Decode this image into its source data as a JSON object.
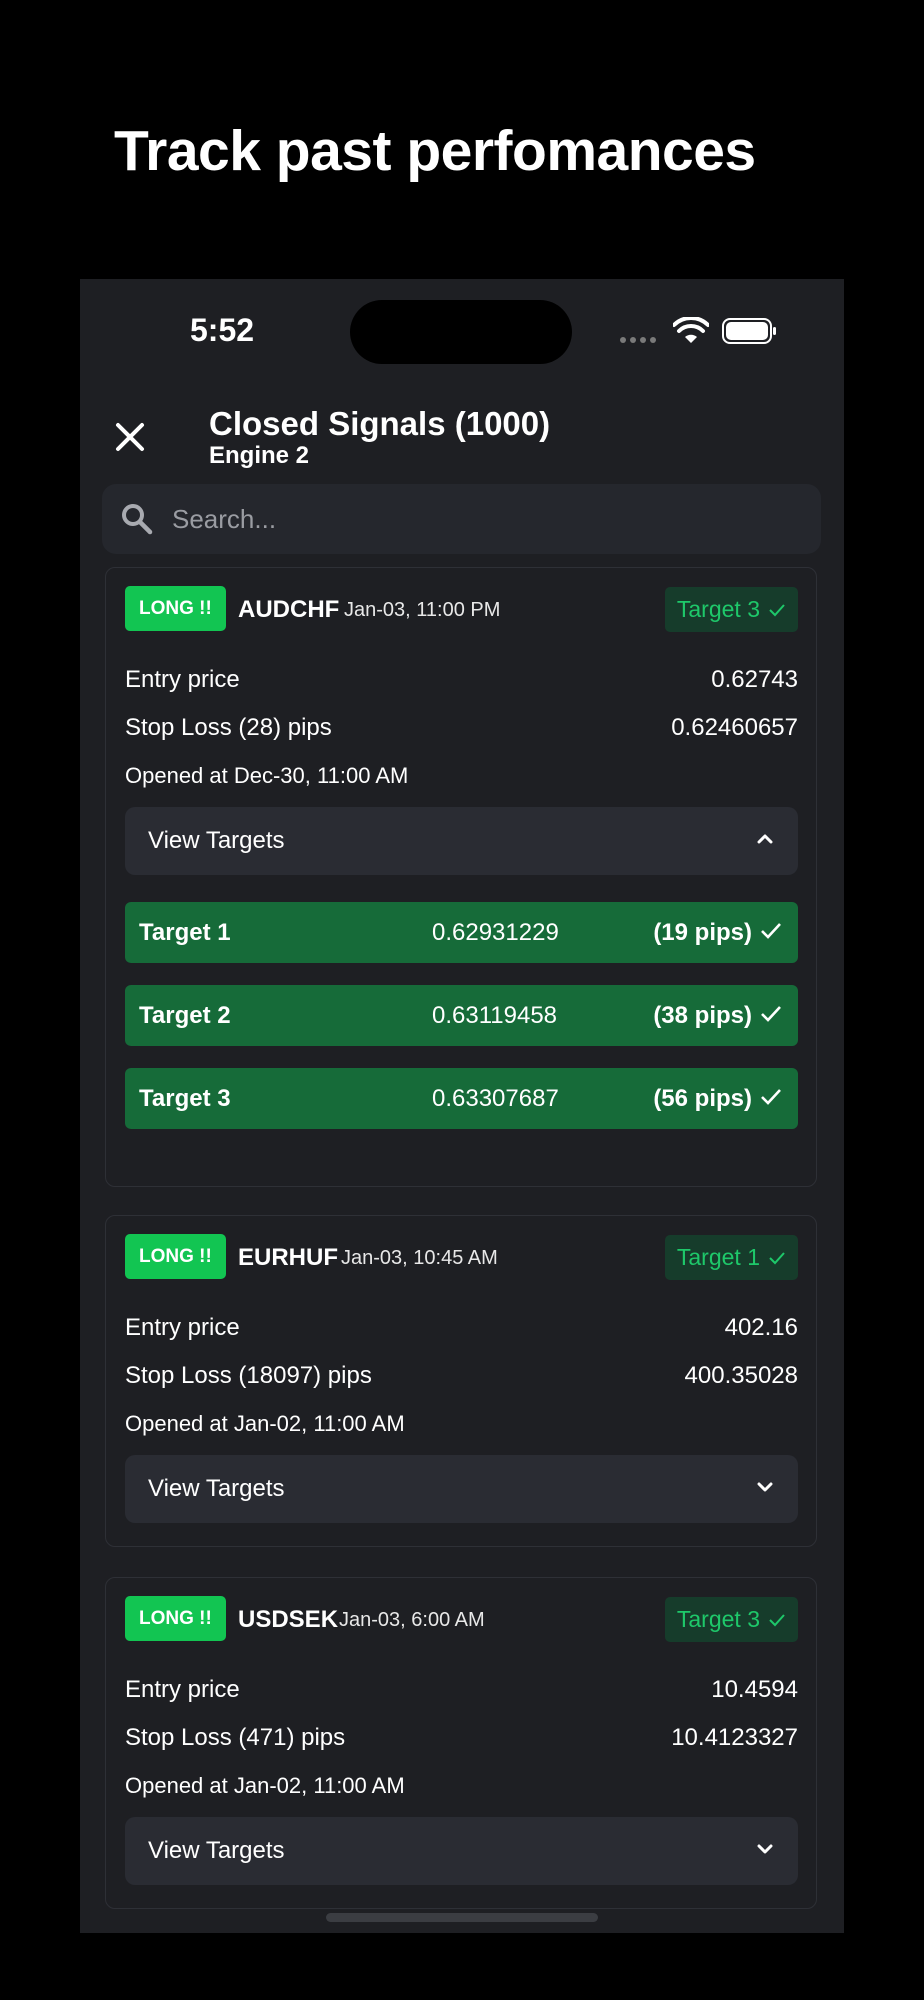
{
  "headline": "Track past perfomances",
  "status_bar": {
    "time": "5:52"
  },
  "header": {
    "title": "Closed Signals (1000)",
    "subtitle": "Engine 2"
  },
  "search": {
    "placeholder": "Search..."
  },
  "signals": [
    {
      "direction": "LONG !!",
      "pair": "AUDCHF",
      "date": "Jan-03, 11:00 PM",
      "target_badge": "Target 3",
      "entry_label": "Entry price",
      "entry_value": "0.62743",
      "stop_label": "Stop Loss (28) pips",
      "stop_value": "0.62460657",
      "opened": "Opened at Dec-30, 11:00 AM",
      "view_targets_label": "View Targets",
      "expanded": true,
      "targets": [
        {
          "name": "Target 1",
          "price": "0.62931229",
          "pips": "(19 pips)"
        },
        {
          "name": "Target 2",
          "price": "0.63119458",
          "pips": "(38 pips)"
        },
        {
          "name": "Target 3",
          "price": "0.63307687",
          "pips": "(56 pips)"
        }
      ]
    },
    {
      "direction": "LONG !!",
      "pair": "EURHUF",
      "date": "Jan-03, 10:45 AM",
      "target_badge": "Target 1",
      "entry_label": "Entry price",
      "entry_value": "402.16",
      "stop_label": "Stop Loss (18097) pips",
      "stop_value": "400.35028",
      "opened": "Opened at Jan-02, 11:00 AM",
      "view_targets_label": "View Targets",
      "expanded": false
    },
    {
      "direction": "LONG !!",
      "pair": "USDSEK",
      "date": "Jan-03, 6:00 AM",
      "target_badge": "Target 3",
      "entry_label": "Entry price",
      "entry_value": "10.4594",
      "stop_label": "Stop Loss (471) pips",
      "stop_value": "10.4123327",
      "opened": "Opened at Jan-02, 11:00 AM",
      "view_targets_label": "View Targets",
      "expanded": false
    }
  ],
  "colors": {
    "background": "#000000",
    "surface": "#1e1f23",
    "long_badge": "#12c552",
    "target_badge_bg": "#163c2b",
    "target_badge_text": "#1ec86a",
    "target_row": "#166b39"
  }
}
